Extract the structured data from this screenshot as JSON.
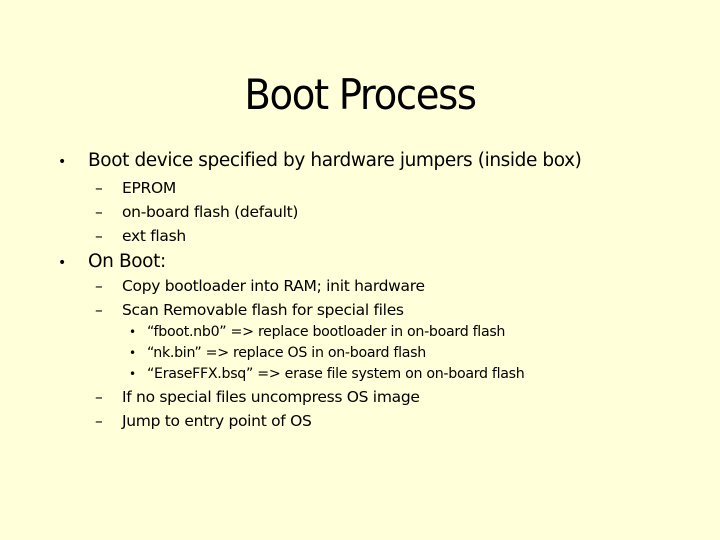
{
  "slide": {
    "title": "Boot Process",
    "background_color": "#ffffd9",
    "bullets": [
      {
        "marker": "•",
        "text": "Boot device specified by hardware jumpers (inside box)",
        "children": [
          {
            "marker": "–",
            "text": "EPROM"
          },
          {
            "marker": "–",
            "text": "on-board flash (default)"
          },
          {
            "marker": "–",
            "text": "ext flash"
          }
        ]
      },
      {
        "marker": "•",
        "text": "On Boot:",
        "children": [
          {
            "marker": "–",
            "text": "Copy bootloader into RAM; init hardware"
          },
          {
            "marker": "–",
            "text": "Scan Removable flash for special files",
            "children": [
              {
                "marker": "•",
                "text": "“fboot.nb0”  => replace bootloader in on-board flash"
              },
              {
                "marker": "•",
                "text": "“nk.bin” => replace OS in on-board flash"
              },
              {
                "marker": "•",
                "text": "“EraseFFX.bsq” => erase file system on on-board flash"
              }
            ]
          },
          {
            "marker": "–",
            "text": "If no special files uncompress OS image"
          },
          {
            "marker": "–",
            "text": "Jump to entry point of OS"
          }
        ]
      }
    ]
  }
}
